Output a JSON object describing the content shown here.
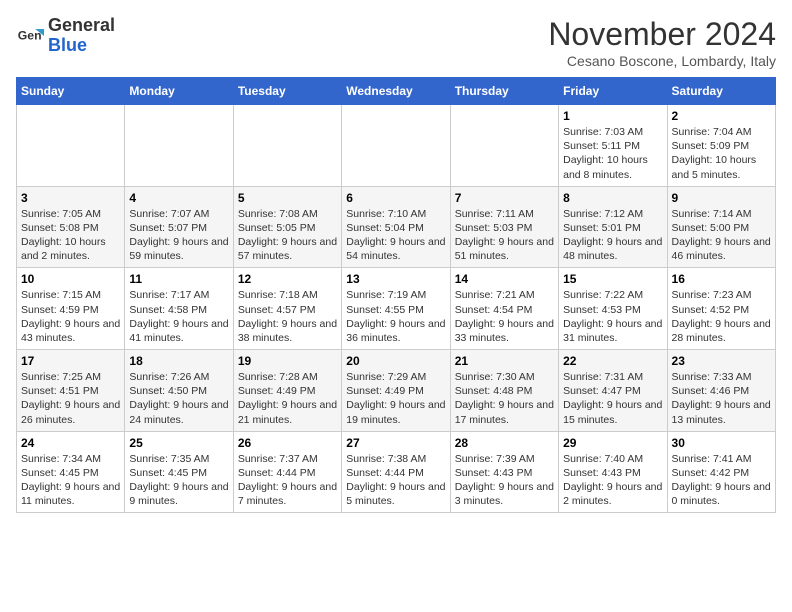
{
  "logo": {
    "general": "General",
    "blue": "Blue"
  },
  "title": "November 2024",
  "location": "Cesano Boscone, Lombardy, Italy",
  "weekdays": [
    "Sunday",
    "Monday",
    "Tuesday",
    "Wednesday",
    "Thursday",
    "Friday",
    "Saturday"
  ],
  "weeks": [
    [
      {
        "day": "",
        "info": ""
      },
      {
        "day": "",
        "info": ""
      },
      {
        "day": "",
        "info": ""
      },
      {
        "day": "",
        "info": ""
      },
      {
        "day": "",
        "info": ""
      },
      {
        "day": "1",
        "info": "Sunrise: 7:03 AM\nSunset: 5:11 PM\nDaylight: 10 hours and 8 minutes."
      },
      {
        "day": "2",
        "info": "Sunrise: 7:04 AM\nSunset: 5:09 PM\nDaylight: 10 hours and 5 minutes."
      }
    ],
    [
      {
        "day": "3",
        "info": "Sunrise: 7:05 AM\nSunset: 5:08 PM\nDaylight: 10 hours and 2 minutes."
      },
      {
        "day": "4",
        "info": "Sunrise: 7:07 AM\nSunset: 5:07 PM\nDaylight: 9 hours and 59 minutes."
      },
      {
        "day": "5",
        "info": "Sunrise: 7:08 AM\nSunset: 5:05 PM\nDaylight: 9 hours and 57 minutes."
      },
      {
        "day": "6",
        "info": "Sunrise: 7:10 AM\nSunset: 5:04 PM\nDaylight: 9 hours and 54 minutes."
      },
      {
        "day": "7",
        "info": "Sunrise: 7:11 AM\nSunset: 5:03 PM\nDaylight: 9 hours and 51 minutes."
      },
      {
        "day": "8",
        "info": "Sunrise: 7:12 AM\nSunset: 5:01 PM\nDaylight: 9 hours and 48 minutes."
      },
      {
        "day": "9",
        "info": "Sunrise: 7:14 AM\nSunset: 5:00 PM\nDaylight: 9 hours and 46 minutes."
      }
    ],
    [
      {
        "day": "10",
        "info": "Sunrise: 7:15 AM\nSunset: 4:59 PM\nDaylight: 9 hours and 43 minutes."
      },
      {
        "day": "11",
        "info": "Sunrise: 7:17 AM\nSunset: 4:58 PM\nDaylight: 9 hours and 41 minutes."
      },
      {
        "day": "12",
        "info": "Sunrise: 7:18 AM\nSunset: 4:57 PM\nDaylight: 9 hours and 38 minutes."
      },
      {
        "day": "13",
        "info": "Sunrise: 7:19 AM\nSunset: 4:55 PM\nDaylight: 9 hours and 36 minutes."
      },
      {
        "day": "14",
        "info": "Sunrise: 7:21 AM\nSunset: 4:54 PM\nDaylight: 9 hours and 33 minutes."
      },
      {
        "day": "15",
        "info": "Sunrise: 7:22 AM\nSunset: 4:53 PM\nDaylight: 9 hours and 31 minutes."
      },
      {
        "day": "16",
        "info": "Sunrise: 7:23 AM\nSunset: 4:52 PM\nDaylight: 9 hours and 28 minutes."
      }
    ],
    [
      {
        "day": "17",
        "info": "Sunrise: 7:25 AM\nSunset: 4:51 PM\nDaylight: 9 hours and 26 minutes."
      },
      {
        "day": "18",
        "info": "Sunrise: 7:26 AM\nSunset: 4:50 PM\nDaylight: 9 hours and 24 minutes."
      },
      {
        "day": "19",
        "info": "Sunrise: 7:28 AM\nSunset: 4:49 PM\nDaylight: 9 hours and 21 minutes."
      },
      {
        "day": "20",
        "info": "Sunrise: 7:29 AM\nSunset: 4:49 PM\nDaylight: 9 hours and 19 minutes."
      },
      {
        "day": "21",
        "info": "Sunrise: 7:30 AM\nSunset: 4:48 PM\nDaylight: 9 hours and 17 minutes."
      },
      {
        "day": "22",
        "info": "Sunrise: 7:31 AM\nSunset: 4:47 PM\nDaylight: 9 hours and 15 minutes."
      },
      {
        "day": "23",
        "info": "Sunrise: 7:33 AM\nSunset: 4:46 PM\nDaylight: 9 hours and 13 minutes."
      }
    ],
    [
      {
        "day": "24",
        "info": "Sunrise: 7:34 AM\nSunset: 4:45 PM\nDaylight: 9 hours and 11 minutes."
      },
      {
        "day": "25",
        "info": "Sunrise: 7:35 AM\nSunset: 4:45 PM\nDaylight: 9 hours and 9 minutes."
      },
      {
        "day": "26",
        "info": "Sunrise: 7:37 AM\nSunset: 4:44 PM\nDaylight: 9 hours and 7 minutes."
      },
      {
        "day": "27",
        "info": "Sunrise: 7:38 AM\nSunset: 4:44 PM\nDaylight: 9 hours and 5 minutes."
      },
      {
        "day": "28",
        "info": "Sunrise: 7:39 AM\nSunset: 4:43 PM\nDaylight: 9 hours and 3 minutes."
      },
      {
        "day": "29",
        "info": "Sunrise: 7:40 AM\nSunset: 4:43 PM\nDaylight: 9 hours and 2 minutes."
      },
      {
        "day": "30",
        "info": "Sunrise: 7:41 AM\nSunset: 4:42 PM\nDaylight: 9 hours and 0 minutes."
      }
    ]
  ]
}
